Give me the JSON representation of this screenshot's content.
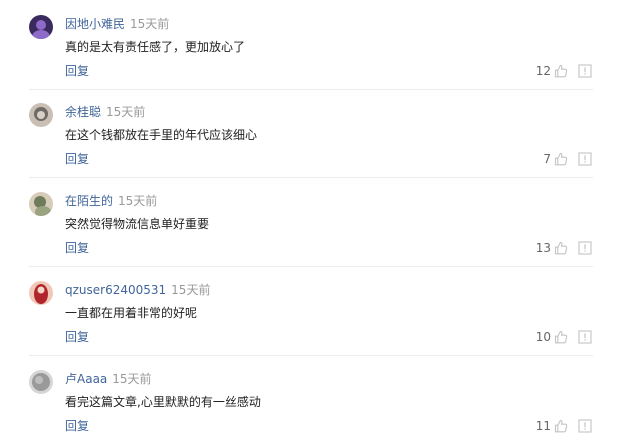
{
  "comments": [
    {
      "username": "因地小难民",
      "time": "15天前",
      "content": "真的是太有责任感了，更加放心了",
      "reply_label": "回复",
      "likes": "12",
      "avatar_colors": [
        "#3a2a5e",
        "#8e6ac9"
      ]
    },
    {
      "username": "余桂聪",
      "time": "15天前",
      "content": "在这个钱都放在手里的年代应该细心",
      "reply_label": "回复",
      "likes": "7",
      "avatar_colors": [
        "#6e6a66",
        "#c9bfb5"
      ]
    },
    {
      "username": "在陌生的",
      "time": "15天前",
      "content": "突然觉得物流信息单好重要",
      "reply_label": "回复",
      "likes": "13",
      "avatar_colors": [
        "#6f7a5a",
        "#d7cbb9"
      ]
    },
    {
      "username": "qzuser62400531",
      "time": "15天前",
      "content": "一直都在用着非常的好呢",
      "reply_label": "回复",
      "likes": "10",
      "avatar_colors": [
        "#b0242c",
        "#f1c8b8"
      ]
    },
    {
      "username": "卢Aaaa",
      "time": "15天前",
      "content": "看完这篇文章,心里默默的有一丝感动",
      "reply_label": "回复",
      "likes": "11",
      "avatar_colors": [
        "#9a9a9a",
        "#d6d6d6"
      ]
    }
  ],
  "icons": {
    "like": "thumbs-up-icon",
    "report": "report-icon"
  },
  "colors": {
    "username": "#406599",
    "time": "#999999",
    "reply": "#406599",
    "content": "#222222",
    "icon": "#c4c4c4"
  }
}
